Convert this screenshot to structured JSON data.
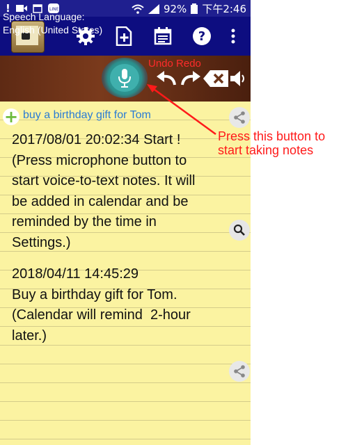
{
  "statusbar": {
    "battery": "92%",
    "time": "下午2:46",
    "icons": [
      "alert-icon",
      "video-icon",
      "calendar-icon",
      "line-icon",
      "wifi-icon",
      "signal-icon",
      "battery-icon"
    ]
  },
  "appbar": {
    "icons": [
      "app-logo-icon",
      "gear-icon",
      "add-file-icon",
      "calendar-icon",
      "help-icon",
      "more-vert-icon"
    ]
  },
  "toolbar": {
    "language_label": "Speech Language:",
    "language_value": "English (United States)",
    "undo_redo_label": "Undo Redo",
    "icons": [
      "mic-icon",
      "undo-icon",
      "redo-icon",
      "backspace-icon",
      "speaker-icon"
    ]
  },
  "note": {
    "title": "buy a birthday gift for Tom",
    "entry1": "2017/08/01 20:02:34 Start !\n(Press microphone button to\nstart voice-to-text notes. It will\nbe added in calendar and be\nreminded by the time in\nSettings.)",
    "entry2": "2018/04/11 14:45:29\nBuy a birthday gift for Tom.\n(Calendar will remind  2-hour\nlater.)"
  },
  "callout": {
    "line1": "Press this button to",
    "line2": "start taking notes"
  },
  "colors": {
    "appbar": "#0d0d80",
    "toolbar": "#6b3318",
    "paper": "#fbf3a1",
    "callout": "#ff1a1a",
    "title": "#2a7bd4"
  }
}
